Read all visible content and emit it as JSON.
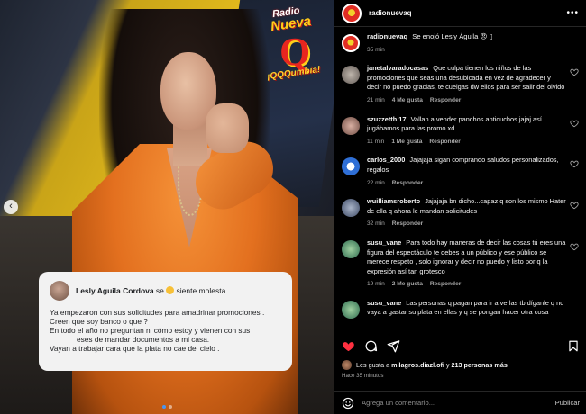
{
  "post": {
    "account": "radionuevaq",
    "logo": {
      "radio": "Radio",
      "nueva": "Nueva",
      "q": "Q",
      "slogan": "¡QQQumbia!"
    }
  },
  "fb_card": {
    "name": "Lesly Aguila Cordova",
    "feeling_prefix": "se",
    "feeling": "siente molesta.",
    "lines": [
      "Ya empezaron con sus solicitudes para amadrinar promociones .",
      "Creen que soy banco o que ?",
      "En todo el año no preguntan ni cómo estoy y vienen con sus",
      "eses de mandar documentos a mi casa.",
      "Vayan a trabajar cara    que la plata no cae del cielo ."
    ]
  },
  "carousel": {
    "active_index": 0,
    "count": 2
  },
  "caption": {
    "user": "radionuevaq",
    "text": "Se enojó Lesly Águila 😠 ▯",
    "time": "35 min"
  },
  "comments": [
    {
      "user": "janetalvaradocasas",
      "text": "Que culpa tienen los niños de las promociones que seas una desubicada en vez de agradecer y decir no puedo gracias, te cuelgas dw ellos para ser salir del olvido",
      "time": "21 min",
      "likes": "4 Me gusta",
      "reply": "Responder"
    },
    {
      "user": "szuzzetth.17",
      "text": "Vallan a vender panchos anticuchos jajaj así jugábamos para las promo xd",
      "time": "11 min",
      "likes": "1 Me gusta",
      "reply": "Responder"
    },
    {
      "user": "carlos_2000",
      "text": "Jajajaja sigan comprando saludos personalizados, regalos",
      "time": "22 min",
      "likes": "",
      "reply": "Responder"
    },
    {
      "user": "wuilliamsroberto",
      "text": "Jajajaja bn dicho...capaz q son los mismo Hater de ella q ahora le mandan solicitudes",
      "time": "32 min",
      "likes": "",
      "reply": "Responder"
    },
    {
      "user": "susu_vane",
      "text": "Para todo hay maneras de decir las cosas tú eres una figura del espectáculo te debes a un público y ese público se merece respeto , solo ignorar y decir no puedo y listo por q la expresión así tan grotesco",
      "time": "19 min",
      "likes": "2 Me gusta",
      "reply": "Responder"
    },
    {
      "user": "susu_vane",
      "text": "Las personas q pagan para ir a verlas tb díganle q no vaya a gastar su plata en ellas y q se pongan hacer otra cosa",
      "time": "",
      "likes": "",
      "reply": ""
    }
  ],
  "likes": {
    "prefix": "Les gusta a",
    "user": "milagros.diazl.ofi",
    "mid": "y",
    "count": "213 personas más",
    "ago": "Hace 35 minutos"
  },
  "comment_input": {
    "placeholder": "Agrega un comentario...",
    "publish": "Publicar"
  },
  "colors": {
    "like_red": "#ff3040",
    "panel_bg": "#000000",
    "muted": "#a8a8a8",
    "jacket": "#f08a2e"
  },
  "icons": [
    "more-icon",
    "heart-icon",
    "comment-icon",
    "share-icon",
    "bookmark-icon",
    "emoji-icon",
    "chevron-left-icon"
  ]
}
